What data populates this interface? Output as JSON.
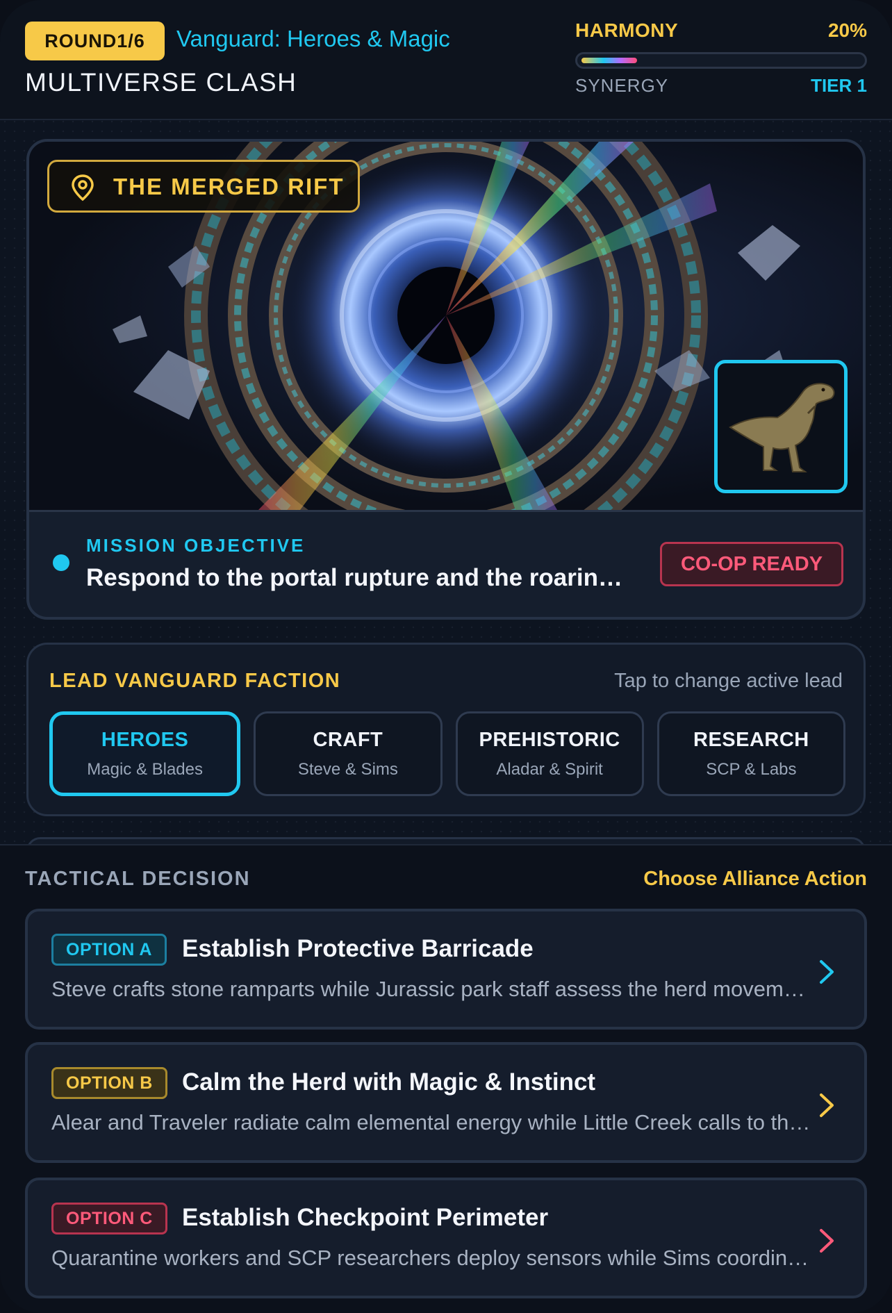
{
  "header": {
    "round_badge": "ROUND1/6",
    "game_title": "Vanguard: Heroes & Magic",
    "mode_title": "MULTIVERSE CLASH",
    "harmony": {
      "label": "HARMONY",
      "value": "20%",
      "fraction": 0.2
    },
    "synergy": {
      "label": "SYNERGY",
      "tier": "TIER 1"
    }
  },
  "scene": {
    "location": "THE MERGED RIFT",
    "location_icon": "map-pin-icon",
    "portrait_icon": "t-rex-icon",
    "objective_label": "MISSION OBJECTIVE",
    "objective_text": "Respond to the portal rupture and the roaring dinosaur herd",
    "status_badge": "CO-OP READY"
  },
  "factions": {
    "title": "LEAD VANGUARD FACTION",
    "hint": "Tap to change active lead",
    "tabs": [
      {
        "name": "HEROES",
        "sub": "Magic & Blades",
        "active": true
      },
      {
        "name": "CRAFT",
        "sub": "Steve & Sims",
        "active": false
      },
      {
        "name": "PREHISTORIC",
        "sub": "Aladar & Spirit",
        "active": false
      },
      {
        "name": "RESEARCH",
        "sub": "SCP & Labs",
        "active": false
      }
    ]
  },
  "tactical": {
    "label": "TACTICAL DECISION",
    "cta": "Choose Alliance Action",
    "options": [
      {
        "badge": "OPTION A",
        "title": "Establish Protective Barricade",
        "desc": "Steve crafts stone ramparts while Jurassic park staff assess the herd movements",
        "arrow_icon": "chevron-right-icon"
      },
      {
        "badge": "OPTION B",
        "title": "Calm the Herd with Magic & Instinct",
        "desc": "Alear and Traveler radiate calm elemental energy while Little Creek calls to the herd",
        "arrow_icon": "chevron-right-icon"
      },
      {
        "badge": "OPTION C",
        "title": "Establish Checkpoint Perimeter",
        "desc": "Quarantine workers and SCP researchers deploy sensors while Sims coordinate evacuation",
        "arrow_icon": "chevron-right-icon"
      }
    ]
  },
  "colors": {
    "gold": "#f7c948",
    "cyan": "#20c8f0",
    "red": "#ff5a7a",
    "background": "#0d1420"
  }
}
